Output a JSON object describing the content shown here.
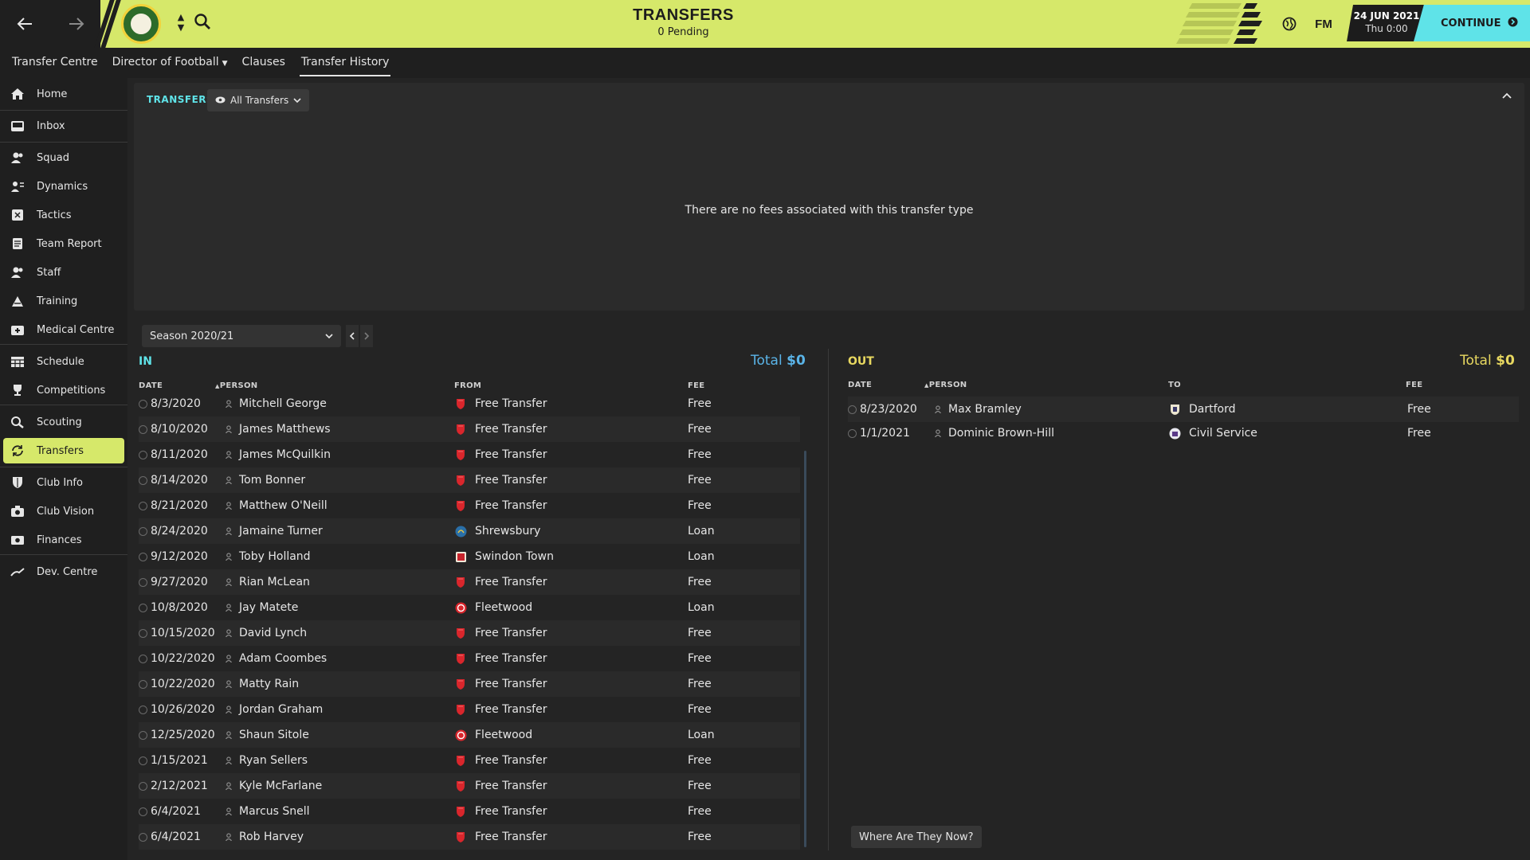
{
  "header": {
    "title": "TRANSFERS",
    "subtitle": "0 Pending",
    "date": "24 JUN 2021",
    "time": "Thu 0:00",
    "fm_label": "FM",
    "continue_label": "CONTINUE",
    "accent_color": "#d6e86a",
    "continue_color": "#5fe3e8"
  },
  "subtabs": [
    {
      "label": "Transfer Centre"
    },
    {
      "label": "Director of Football"
    },
    {
      "label": "Clauses"
    },
    {
      "label": "Transfer History"
    }
  ],
  "sidebar": {
    "items": [
      {
        "label": "Home",
        "icon": "home-icon"
      },
      {
        "label": "Inbox",
        "icon": "inbox-icon"
      },
      {
        "label": "Squad",
        "icon": "squad-icon"
      },
      {
        "label": "Dynamics",
        "icon": "dynamics-icon"
      },
      {
        "label": "Tactics",
        "icon": "tactics-icon"
      },
      {
        "label": "Team Report",
        "icon": "report-icon"
      },
      {
        "label": "Staff",
        "icon": "staff-icon"
      },
      {
        "label": "Training",
        "icon": "training-icon"
      },
      {
        "label": "Medical Centre",
        "icon": "medical-icon"
      },
      {
        "label": "Schedule",
        "icon": "schedule-icon"
      },
      {
        "label": "Competitions",
        "icon": "trophy-icon"
      },
      {
        "label": "Scouting",
        "icon": "scouting-icon"
      },
      {
        "label": "Transfers",
        "icon": "transfers-icon"
      },
      {
        "label": "Club Info",
        "icon": "shield-icon"
      },
      {
        "label": "Club Vision",
        "icon": "vision-icon"
      },
      {
        "label": "Finances",
        "icon": "finances-icon"
      },
      {
        "label": "Dev. Centre",
        "icon": "dev-icon"
      }
    ]
  },
  "fees_panel": {
    "title": "TRANSFERS",
    "filter_label": "All Transfers",
    "message": "There are no fees associated with this transfer type"
  },
  "season": {
    "label": "Season 2020/21"
  },
  "in_section": {
    "title": "IN",
    "total_label": "Total",
    "total_value": "$0",
    "columns": {
      "date": "DATE",
      "person": "PERSON",
      "club": "FROM",
      "fee": "FEE"
    },
    "rows": [
      {
        "date": "8/3/2020",
        "person": "Mitchell George",
        "club": "Free Transfer",
        "club_icon": "free-transfer-icon",
        "fee": "Free"
      },
      {
        "date": "8/10/2020",
        "person": "James Matthews",
        "club": "Free Transfer",
        "club_icon": "free-transfer-icon",
        "fee": "Free"
      },
      {
        "date": "8/11/2020",
        "person": "James McQuilkin",
        "club": "Free Transfer",
        "club_icon": "free-transfer-icon",
        "fee": "Free"
      },
      {
        "date": "8/14/2020",
        "person": "Tom Bonner",
        "club": "Free Transfer",
        "club_icon": "free-transfer-icon",
        "fee": "Free"
      },
      {
        "date": "8/21/2020",
        "person": "Matthew O'Neill",
        "club": "Free Transfer",
        "club_icon": "free-transfer-icon",
        "fee": "Free"
      },
      {
        "date": "8/24/2020",
        "person": "Jamaine Turner",
        "club": "Shrewsbury",
        "club_icon": "shrewsbury-crest-icon",
        "fee": "Loan"
      },
      {
        "date": "9/12/2020",
        "person": "Toby Holland",
        "club": "Swindon Town",
        "club_icon": "swindon-crest-icon",
        "fee": "Loan"
      },
      {
        "date": "9/27/2020",
        "person": "Rian McLean",
        "club": "Free Transfer",
        "club_icon": "free-transfer-icon",
        "fee": "Free"
      },
      {
        "date": "10/8/2020",
        "person": "Jay Matete",
        "club": "Fleetwood",
        "club_icon": "fleetwood-crest-icon",
        "fee": "Loan"
      },
      {
        "date": "10/15/2020",
        "person": "David Lynch",
        "club": "Free Transfer",
        "club_icon": "free-transfer-icon",
        "fee": "Free"
      },
      {
        "date": "10/22/2020",
        "person": "Adam Coombes",
        "club": "Free Transfer",
        "club_icon": "free-transfer-icon",
        "fee": "Free"
      },
      {
        "date": "10/22/2020",
        "person": "Matty Rain",
        "club": "Free Transfer",
        "club_icon": "free-transfer-icon",
        "fee": "Free"
      },
      {
        "date": "10/26/2020",
        "person": "Jordan Graham",
        "club": "Free Transfer",
        "club_icon": "free-transfer-icon",
        "fee": "Free"
      },
      {
        "date": "12/25/2020",
        "person": "Shaun Sitole",
        "club": "Fleetwood",
        "club_icon": "fleetwood-crest-icon",
        "fee": "Loan"
      },
      {
        "date": "1/15/2021",
        "person": "Ryan Sellers",
        "club": "Free Transfer",
        "club_icon": "free-transfer-icon",
        "fee": "Free"
      },
      {
        "date": "2/12/2021",
        "person": "Kyle McFarlane",
        "club": "Free Transfer",
        "club_icon": "free-transfer-icon",
        "fee": "Free"
      },
      {
        "date": "6/4/2021",
        "person": "Marcus Snell",
        "club": "Free Transfer",
        "club_icon": "free-transfer-icon",
        "fee": "Free"
      },
      {
        "date": "6/4/2021",
        "person": "Rob Harvey",
        "club": "Free Transfer",
        "club_icon": "free-transfer-icon",
        "fee": "Free"
      }
    ]
  },
  "out_section": {
    "title": "OUT",
    "total_label": "Total",
    "total_value": "$0",
    "columns": {
      "date": "DATE",
      "person": "PERSON",
      "club": "TO",
      "fee": "FEE"
    },
    "rows": [
      {
        "date": "8/23/2020",
        "person": "Max Bramley",
        "club": "Dartford",
        "club_icon": "dartford-crest-icon",
        "fee": "Free"
      },
      {
        "date": "1/1/2021",
        "person": "Dominic Brown-Hill",
        "club": "Civil Service",
        "club_icon": "civil-service-crest-icon",
        "fee": "Free"
      }
    ],
    "where_button": "Where Are They Now?"
  },
  "colors": {
    "in_accent": "#5fe3e8",
    "in_total": "#5ab4e8",
    "out_accent": "#e8d860",
    "free_transfer_red": "#d9262c"
  }
}
